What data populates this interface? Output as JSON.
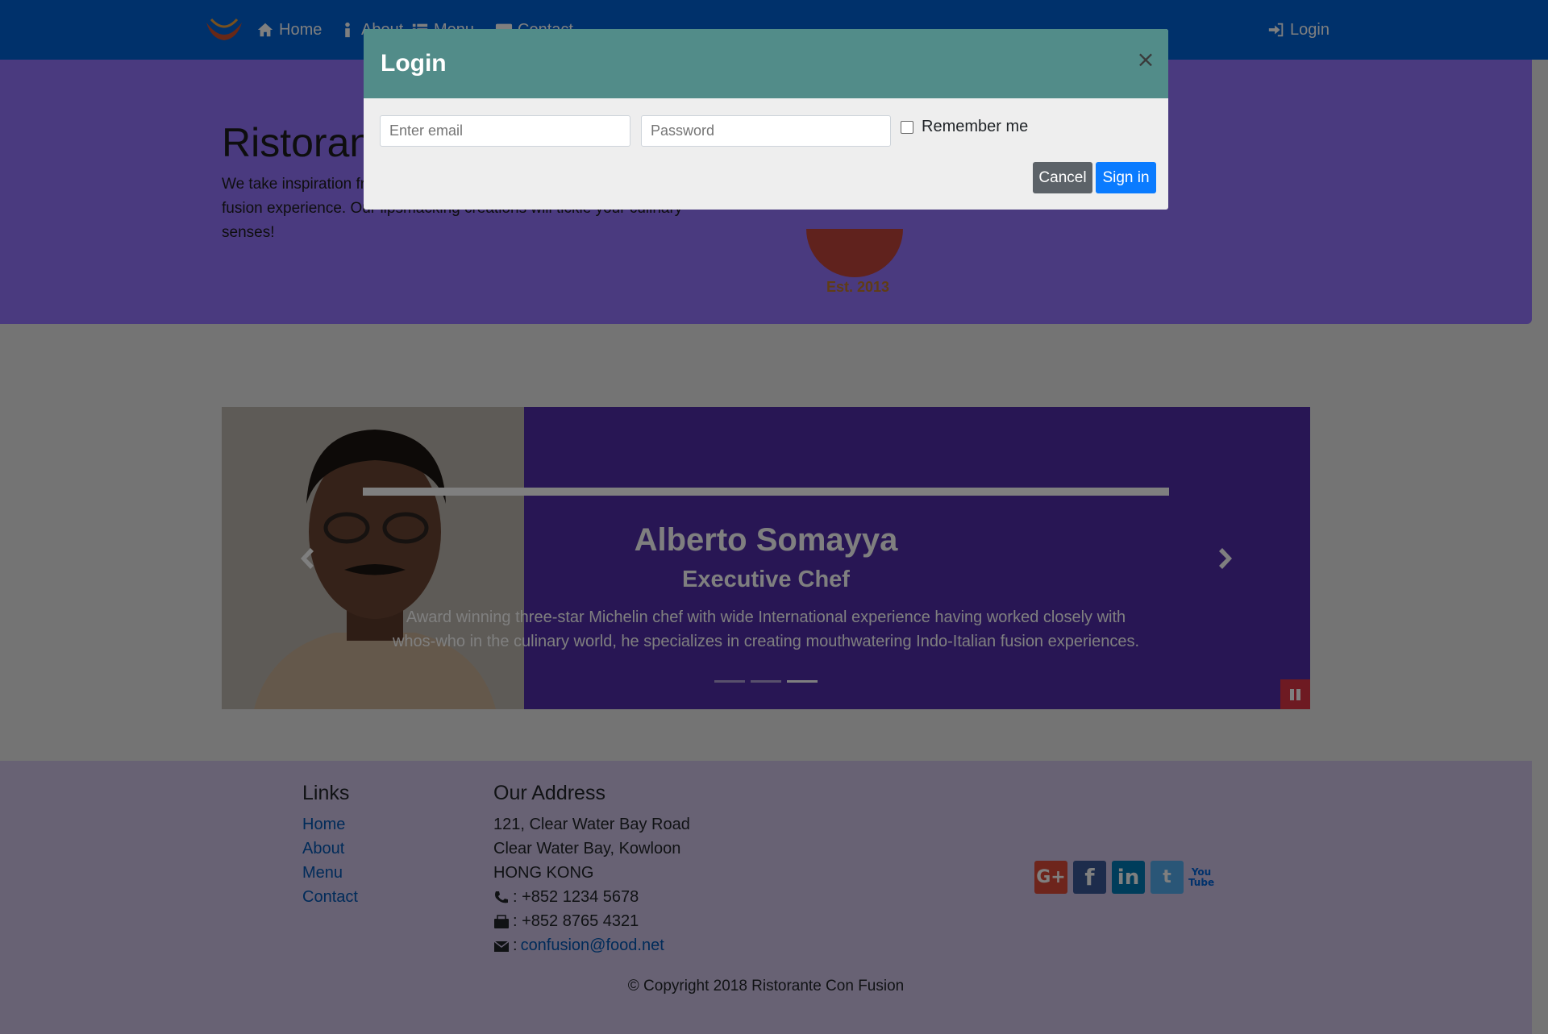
{
  "nav": {
    "items": [
      {
        "label": "Home",
        "icon": "home-icon"
      },
      {
        "label": "About",
        "icon": "info-icon"
      },
      {
        "label": "Menu",
        "icon": "list-icon"
      },
      {
        "label": "Contact",
        "icon": "address-card-icon"
      }
    ],
    "login_label": "Login",
    "login_icon": "sign-in-icon"
  },
  "jumbotron": {
    "title": "Ristorante Con Fusion",
    "text": "We take inspiration from the World's best cuisines, and create a unique fusion experience. Our lipsmacking creations will tickle your culinary senses!",
    "logo_caption": "Est. 2013"
  },
  "carousel": {
    "name": "Alberto Somayya",
    "role": "Executive Chef",
    "description": "Award winning three-star Michelin chef with wide International experience having worked closely with whos-who in the culinary world, he specializes in creating mouthwatering Indo-Italian fusion experiences.",
    "indicators": 3,
    "active_indicator": 3,
    "prev_icon": "chevron-left-icon",
    "next_icon": "chevron-right-icon",
    "pause_icon": "pause-icon"
  },
  "footer": {
    "links_heading": "Links",
    "links": [
      "Home",
      "About",
      "Menu",
      "Contact"
    ],
    "address_heading": "Our Address",
    "address_lines": [
      "121, Clear Water Bay Road",
      "Clear Water Bay, Kowloon",
      "HONG KONG"
    ],
    "phone": ": +852 1234 5678",
    "fax": ": +852 8765 4321",
    "email_prefix": ":",
    "email": "confusion@food.net",
    "social": [
      {
        "name": "google-plus",
        "glyph": "G+"
      },
      {
        "name": "facebook",
        "glyph": "f"
      },
      {
        "name": "linkedin",
        "glyph": "in"
      },
      {
        "name": "twitter",
        "glyph": "t"
      },
      {
        "name": "youtube",
        "glyph": "You Tube"
      }
    ],
    "copyright": "© Copyright 2018 Ristorante Con Fusion"
  },
  "modal": {
    "title": "Login",
    "close_glyph": "×",
    "email_placeholder": "Enter email",
    "password_placeholder": "Password",
    "remember_label": "Remember me",
    "cancel_label": "Cancel",
    "signin_label": "Sign in"
  },
  "colors": {
    "navbar": "#0063d6",
    "jumbotron": "#9575ff",
    "carousel": "#512da8",
    "footer": "#d1c4e9",
    "modal_header": "#528c89",
    "signin": "#0a7bff",
    "cancel": "#5c6268",
    "pause": "#dc3545"
  }
}
